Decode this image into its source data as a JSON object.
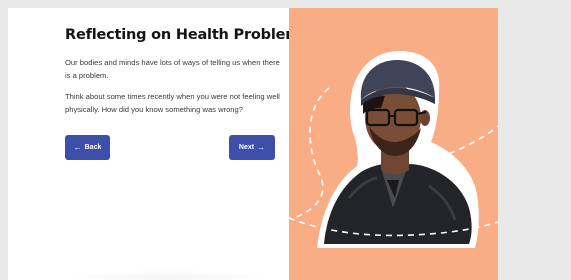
{
  "lesson": {
    "title": "Reflecting on Health Problems",
    "paragraph_1": "Our bodies and minds have lots of ways of telling us when there is a problem.",
    "paragraph_2": "Think about some times recently when you were not feeling well physically. How did you know something was wrong?"
  },
  "navigation": {
    "back_label": "Back",
    "back_icon": "arrow-left-icon",
    "next_label": "Next",
    "next_icon": "arrow-right-icon"
  },
  "illustration": {
    "subject": "cutout photo of a young man in glasses and beanie",
    "background_color": "#f8ad85"
  },
  "colors": {
    "button": "#3d4fa8",
    "title": "#141414",
    "panel": "#f8ad85"
  }
}
